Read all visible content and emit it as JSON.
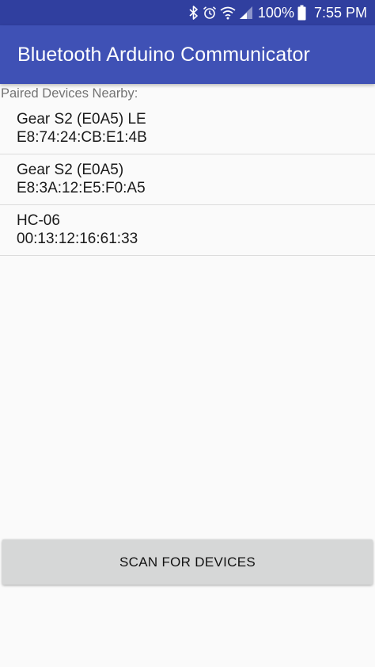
{
  "status_bar": {
    "icons": [
      "bluetooth-icon",
      "alarm-icon",
      "wifi-icon",
      "signal-icon",
      "battery-icon"
    ],
    "battery_percent": "100%",
    "time": "7:55 PM"
  },
  "app_bar": {
    "title": "Bluetooth Arduino Communicator"
  },
  "main": {
    "section_label": "Paired Devices Nearby:",
    "devices": [
      {
        "name": "Gear S2 (E0A5) LE",
        "address": "E8:74:24:CB:E1:4B"
      },
      {
        "name": "Gear S2 (E0A5)",
        "address": "E8:3A:12:E5:F0:A5"
      },
      {
        "name": "HC-06",
        "address": "00:13:12:16:61:33"
      }
    ],
    "scan_button_label": "SCAN FOR DEVICES"
  },
  "colors": {
    "status_bar": "#303f9f",
    "app_bar": "#3f51b5",
    "background": "#fafafa",
    "button": "#d6d7d7"
  }
}
